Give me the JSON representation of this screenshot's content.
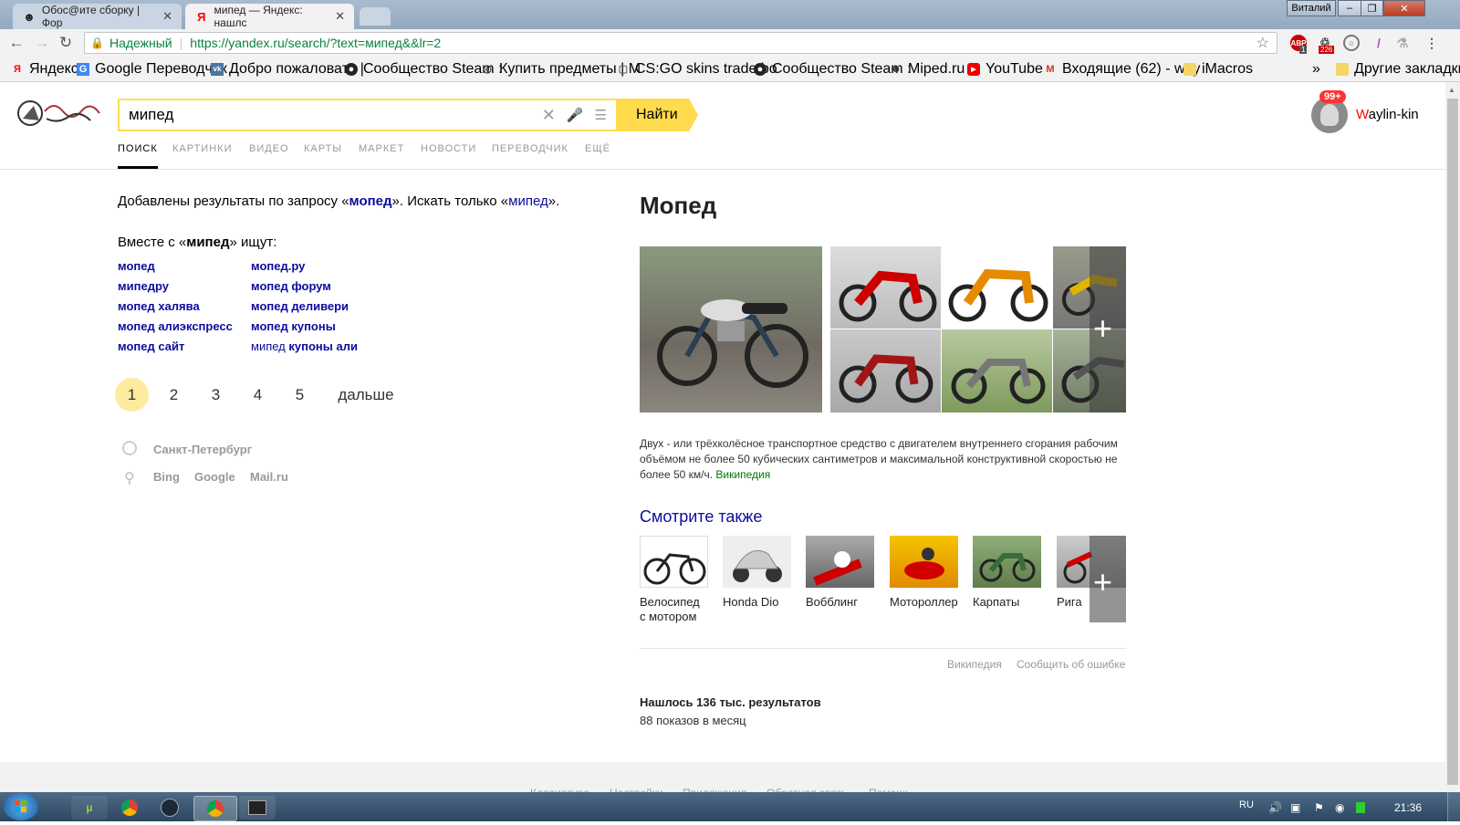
{
  "browser": {
    "tabs": [
      {
        "title": "Обос@ите сборку | Фор",
        "favicon": "forum-icon"
      },
      {
        "title": "мипед — Яндекс: нашлс",
        "favicon": "Я"
      }
    ],
    "window_user": "Виталий",
    "security_label": "Надежный",
    "url": "https://yandex.ru/search/?text=мипед&&lr=2",
    "extensions": {
      "abp_badge": "1",
      "counter_badge": "226"
    },
    "bookmarks": [
      {
        "label": "Яндекс",
        "icon": "Я"
      },
      {
        "label": "Google Переводчик",
        "icon": "G"
      },
      {
        "label": "Добро пожаловать |",
        "icon": "vk"
      },
      {
        "label": "Сообщество Steam :",
        "icon": "steam"
      },
      {
        "label": "Купить предметы | М",
        "icon": "o"
      },
      {
        "label": "CS:GO skins trade bo",
        "icon": "doc"
      },
      {
        "label": "Сообщество Steam :",
        "icon": "steam"
      },
      {
        "label": "Miped.ru",
        "icon": "person"
      },
      {
        "label": "YouTube",
        "icon": "yt"
      },
      {
        "label": "Входящие (62) - way",
        "icon": "M"
      },
      {
        "label": "iMacros",
        "icon": "folder"
      }
    ],
    "bookmarks_overflow": "»",
    "other_bookmarks": "Другие закладки"
  },
  "yandex": {
    "query": "мипед",
    "find_button": "Найти",
    "user": {
      "first_letter": "W",
      "rest": "aylin-kin",
      "notifications": "99+"
    },
    "nav_tabs": [
      "ПОИСК",
      "КАРТИНКИ",
      "ВИДЕО",
      "КАРТЫ",
      "МАРКЕТ",
      "НОВОСТИ",
      "ПЕРЕВОДЧИК",
      "ЕЩЁ"
    ],
    "correction": {
      "prefix": "Добавлены результаты по запросу «",
      "corrected": "мопед",
      "middle": "». Искать только «",
      "original": "мипед",
      "suffix": "»."
    },
    "related": {
      "prefix": "Вместе с «",
      "word": "мипед",
      "suffix": "» ищут:",
      "col1": [
        "мопед",
        "мипедру",
        "мопед халява",
        "мопед алиэкспресс",
        "мопед сайт"
      ],
      "col2": [
        "мопед.ру",
        "мопед форум",
        "мопед деливери",
        "мопед купоны"
      ],
      "last_prefix": "мипед",
      "last_rest": " купоны али"
    },
    "pagination": {
      "current": "1",
      "pages": [
        "2",
        "3",
        "4",
        "5"
      ],
      "next": "дальше"
    },
    "region": "Санкт-Петербург",
    "other_engines": [
      "Bing",
      "Google",
      "Mail.ru"
    ],
    "wizard": {
      "title": "Мопед",
      "description": "Двух - или трёхколёсное транспортное средство с двигателем внутреннего сгорания рабочим объёмом не более 50 кубических сантиметров и максимальной конструктивной скоростью не более 50 км/ч.",
      "source": "Википедия",
      "see_also_title": "Смотрите также",
      "see_also": [
        {
          "line1": "Велосипед",
          "line2": "с мотором"
        },
        {
          "line1": "Honda Dio",
          "line2": ""
        },
        {
          "line1": "Вобблинг",
          "line2": ""
        },
        {
          "line1": "Мотороллер",
          "line2": ""
        },
        {
          "line1": "Карпаты",
          "line2": ""
        },
        {
          "line1": "Рига",
          "line2": ""
        }
      ],
      "footer_links": [
        "Википедия",
        "Сообщить об ошибке"
      ]
    },
    "stats": {
      "found": "Нашлось 136 тыс. результатов",
      "shows": "88 показов в месяц"
    },
    "footer_links": [
      "Клавиатура",
      "Настройки",
      "Приложения",
      "Обратная связь",
      "Помощь"
    ]
  },
  "taskbar": {
    "lang": "RU",
    "time": "21:36"
  }
}
